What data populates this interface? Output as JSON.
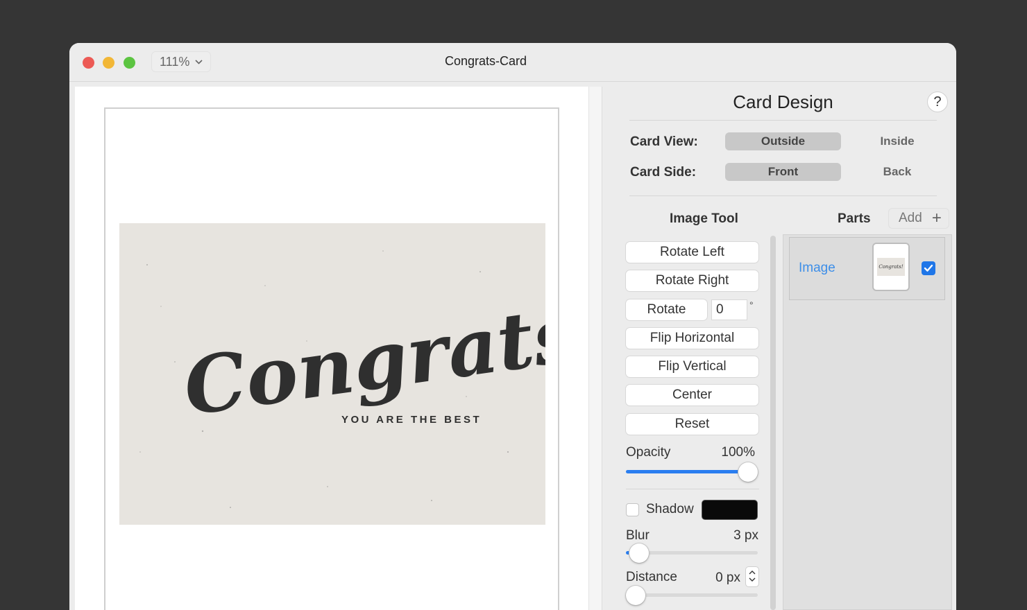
{
  "window": {
    "title": "Congrats-Card",
    "zoom": "111%"
  },
  "card": {
    "headline": "Congrats!",
    "tagline": "YOU ARE THE BEST"
  },
  "panel": {
    "title": "Card Design",
    "help": "?",
    "card_view": {
      "label": "Card View:",
      "options": [
        "Outside",
        "Inside"
      ],
      "selected": "Outside"
    },
    "card_side": {
      "label": "Card Side:",
      "options": [
        "Front",
        "Back"
      ],
      "selected": "Front"
    }
  },
  "image_tool": {
    "title": "Image Tool",
    "buttons": {
      "rotate_left": "Rotate Left",
      "rotate_right": "Rotate Right",
      "rotate": "Rotate",
      "flip_horizontal": "Flip Horizontal",
      "flip_vertical": "Flip Vertical",
      "center": "Center",
      "reset": "Reset"
    },
    "rotate_value": "0",
    "degree_symbol": "°",
    "opacity": {
      "label": "Opacity",
      "value": "100%",
      "fraction": 1.0
    },
    "shadow": {
      "label": "Shadow",
      "checked": false,
      "color": "#0a0a0a"
    },
    "blur": {
      "label": "Blur",
      "value": "3 px"
    },
    "distance": {
      "label": "Distance",
      "value": "0 px"
    }
  },
  "parts": {
    "title": "Parts",
    "add_label": "Add",
    "add_icon": "+",
    "items": [
      {
        "name": "Image",
        "thumb_text": "Congrats!",
        "checked": true
      }
    ]
  },
  "colors": {
    "accent": "#2a7ef0",
    "link": "#3d8ee8",
    "card_bg": "#e7e4df"
  }
}
